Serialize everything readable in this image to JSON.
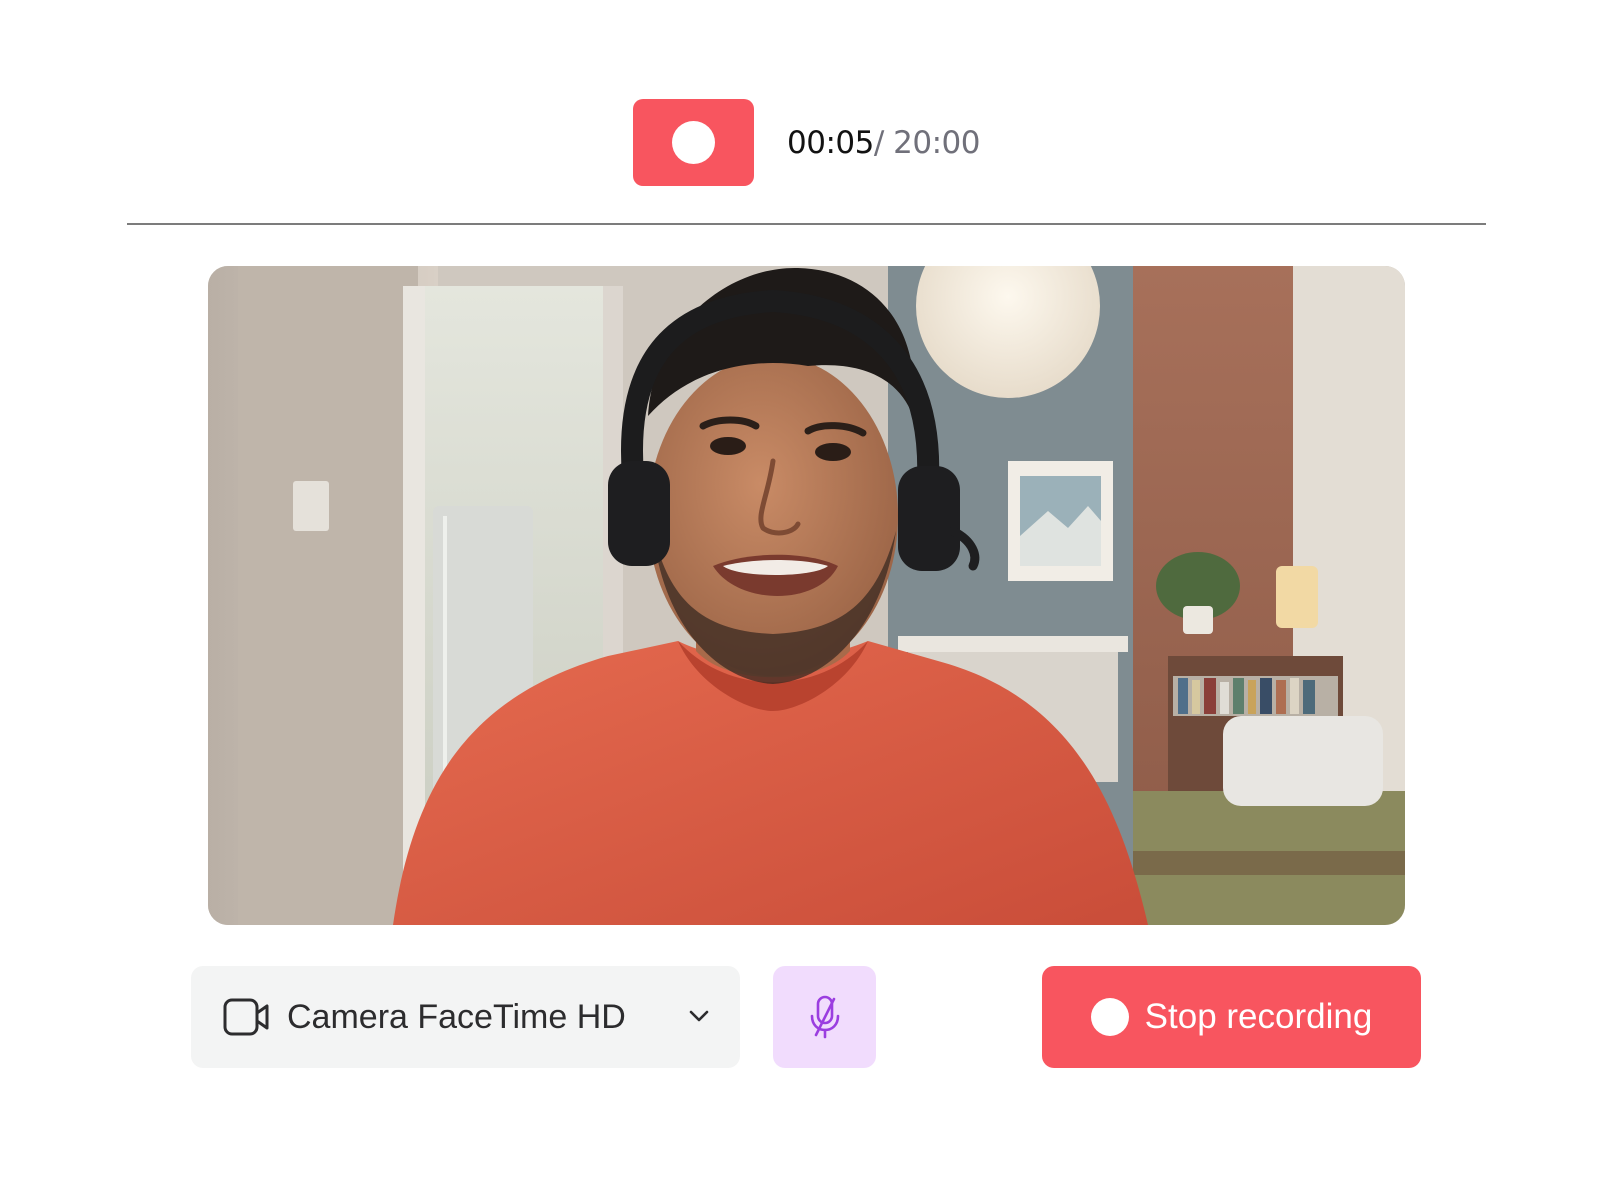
{
  "recorder": {
    "elapsed": "00:05",
    "total": "/ 20:00",
    "accent_color": "#f8555f"
  },
  "preview": {
    "content": "webcam-feed"
  },
  "controls": {
    "camera": {
      "icon": "video-camera-icon",
      "selected": "Camera FaceTime HD",
      "dropdown_icon": "chevron-down-icon"
    },
    "microphone": {
      "icon": "microphone-off-icon",
      "state": "muted",
      "color": "#9b3ee0"
    },
    "stop": {
      "icon": "record-dot-icon",
      "label": "Stop recording"
    }
  }
}
